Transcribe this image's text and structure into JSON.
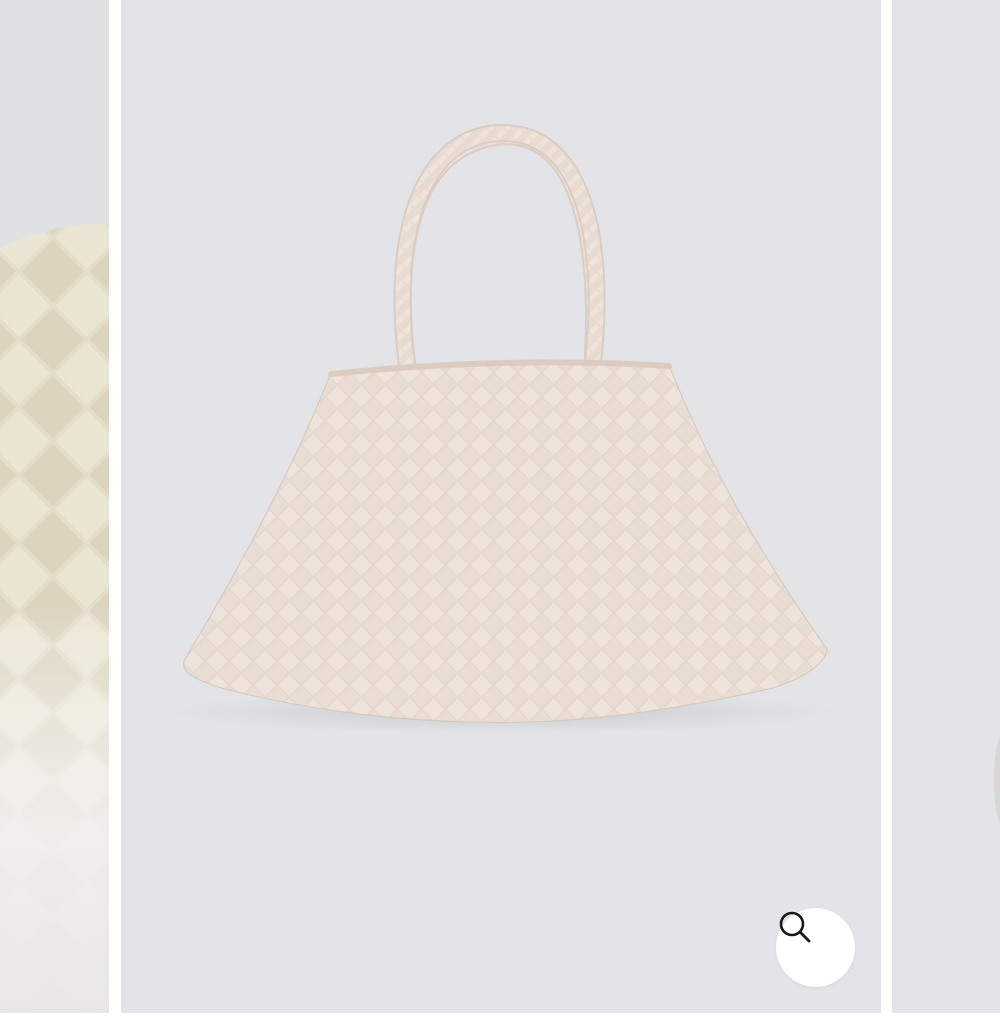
{
  "carousel": {
    "slides": [
      {
        "image": "woven-bag-closeup",
        "state": "previous"
      },
      {
        "image": "woven-tote-bag",
        "state": "current"
      },
      {
        "image": "woven-bag-next",
        "state": "next"
      }
    ],
    "zoom_button": {
      "icon": "search-icon"
    }
  },
  "colors": {
    "background": "#e2e4e7",
    "bag": "#ede0d8",
    "bag_shadow": "#cfc2ba",
    "closeup": "#e6e0cf",
    "zoom_button_bg": "#ffffff",
    "icon": "#1a1a1a"
  }
}
